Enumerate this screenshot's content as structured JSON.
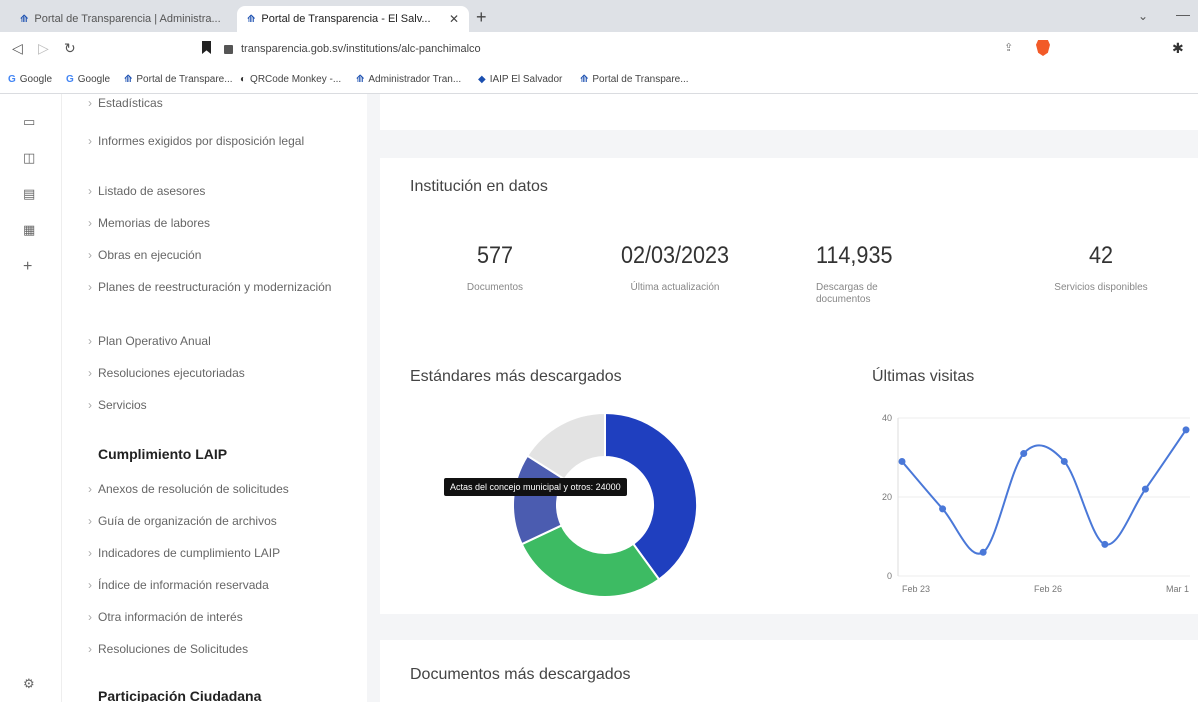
{
  "browser": {
    "tabs": [
      {
        "label": "Portal de Transparencia | Administra..."
      },
      {
        "label": "Portal de Transparencia - El Salv..."
      }
    ],
    "url": "transparencia.gob.sv/institutions/alc-panchimalco",
    "bookmarks": [
      {
        "label": "Google",
        "icon": "G"
      },
      {
        "label": "Google",
        "icon": "G"
      },
      {
        "label": "Portal de Transpare...",
        "icon": "transparencia-icon"
      },
      {
        "label": "QRCode Monkey -...",
        "icon": "qrcode-icon"
      },
      {
        "label": "Administrador Tran...",
        "icon": "transparencia-icon"
      },
      {
        "label": "IAIP El Salvador",
        "icon": "iaip-icon"
      },
      {
        "label": "Portal de Transpare...",
        "icon": "transparencia-icon"
      }
    ]
  },
  "sidemenu": {
    "items_top": [
      "Estadísticas",
      "Informes exigidos por disposición legal",
      "Listado de asesores",
      "Memorias de labores",
      "Obras en ejecución",
      "Planes de reestructuración y modernización",
      "Plan Operativo Anual",
      "Resoluciones ejecutoriadas",
      "Servicios"
    ],
    "section_laip": "Cumplimiento LAIP",
    "items_laip": [
      "Anexos de resolución de solicitudes",
      "Guía de organización de archivos",
      "Indicadores de cumplimiento LAIP",
      "Índice de información reservada",
      "Otra información de interés",
      "Resoluciones de Solicitudes"
    ],
    "section_participacion": "Participación Ciudadana"
  },
  "institucion": {
    "heading": "Institución en datos",
    "stats": [
      {
        "value": "577",
        "label": "Documentos"
      },
      {
        "value": "02/03/2023",
        "label": "Última actualización"
      },
      {
        "value": "114,935",
        "label": "Descargas de documentos"
      },
      {
        "value": "42",
        "label": "Servicios disponibles"
      }
    ]
  },
  "estandares": {
    "heading": "Estándares más descargados",
    "tooltip": "Actas del concejo municipal y otros: 24000"
  },
  "visitas": {
    "heading": "Últimas visitas"
  },
  "documentos": {
    "heading": "Documentos más descargados"
  },
  "chart_data": [
    {
      "type": "pie",
      "variant": "doughnut",
      "slices": [
        {
          "value": 40,
          "color": "#1f3fbf"
        },
        {
          "value": 28,
          "color": "#3dbb63"
        },
        {
          "value": 16,
          "color": "#4b5cb0"
        },
        {
          "value": 16,
          "color": "#e3e3e3"
        }
      ]
    },
    {
      "type": "line",
      "x_ticks": [
        "Feb 23",
        "Feb 26",
        "Mar 1"
      ],
      "y_ticks": [
        0,
        20,
        40
      ],
      "ylim": [
        0,
        40
      ],
      "values": [
        29,
        17,
        6,
        31,
        29,
        8,
        22,
        37
      ],
      "color": "#4a78d8",
      "grid": true
    }
  ]
}
